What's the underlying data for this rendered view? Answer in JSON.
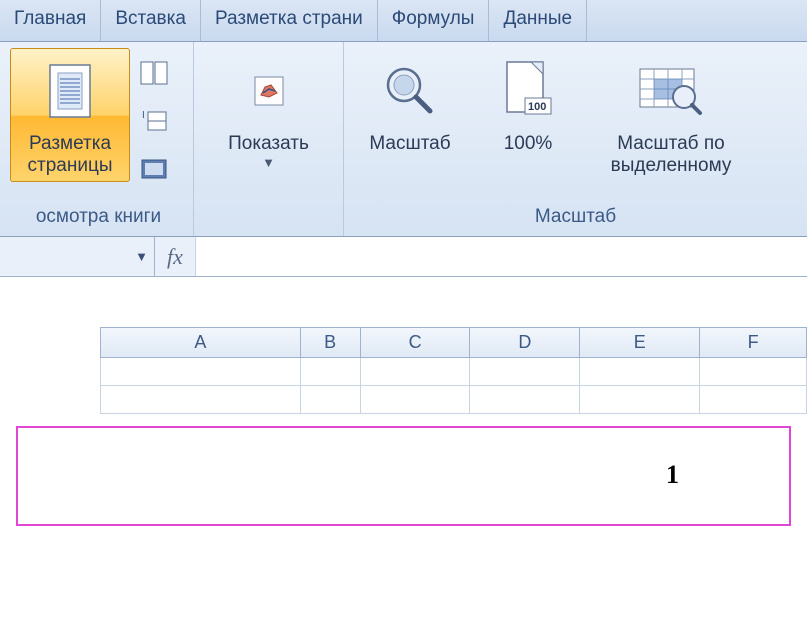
{
  "tabs": {
    "home": "Главная",
    "insert": "Вставка",
    "pageLayout": "Разметка страни",
    "formulas": "Формулы",
    "data": "Данные"
  },
  "ribbon": {
    "viewModes": {
      "pageLayoutBtn": "Разметка\nстраницы",
      "groupLabel": "осмотра книги"
    },
    "show": {
      "label": "Показать"
    },
    "zoom": {
      "zoomBtn": "Масштаб",
      "hundredBtn": "100%",
      "toSelectionBtn": "Масштаб по\nвыделенному",
      "groupLabel": "Масштаб"
    }
  },
  "formulaBar": {
    "fx": "fx",
    "value": ""
  },
  "sheet": {
    "columns": [
      "A",
      "B",
      "C",
      "D",
      "E",
      "F"
    ]
  },
  "page": {
    "number": "1"
  }
}
